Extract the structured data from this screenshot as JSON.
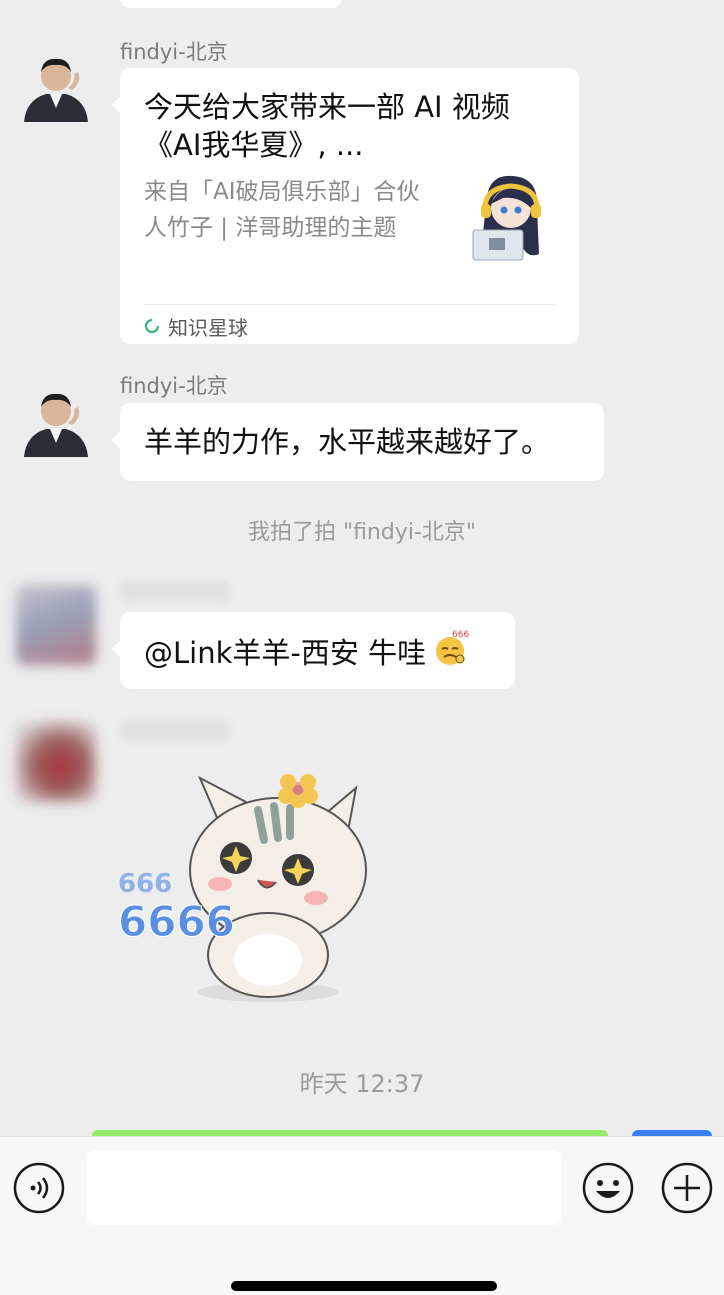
{
  "messages": [
    {
      "sender": "findyi-北京",
      "card": {
        "title": "今天给大家带来一部 AI 视频《AI我华夏》, ...",
        "description": "来自「AI破局俱乐部」合伙人竹子 | 洋哥助理的主题",
        "source": "知识星球",
        "source_icon": "loading-ring-icon"
      }
    },
    {
      "sender": "findyi-北京",
      "text": "羊羊的力作，水平越来越好了。"
    },
    {
      "system": "我拍了拍 \"findyi-北京\""
    },
    {
      "sender": "",
      "text": "@Link羊羊-西安 牛哇",
      "emoji": "666-emoji"
    },
    {
      "sender": "",
      "sticker": "cat-666-sticker"
    },
    {
      "system": "昨天 12:37"
    }
  ],
  "input": {
    "value": "",
    "placeholder": ""
  },
  "colors": {
    "background": "#ededed",
    "bubble": "#ffffff",
    "accent_green": "#95ec69",
    "timestamp_gray": "#9b9b9b"
  }
}
